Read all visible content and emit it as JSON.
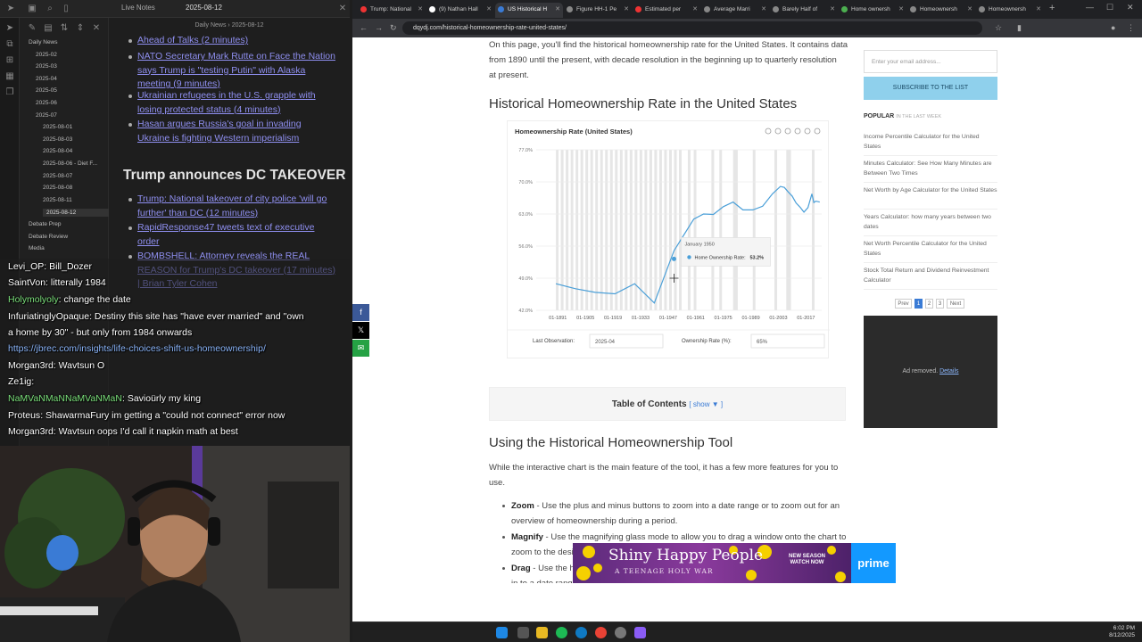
{
  "notes": {
    "tab_live_notes": "Live Notes",
    "tab_date": "2025-08-12",
    "doc_header": "Daily News › 2025-08-12",
    "tree": [
      {
        "label": "Daily News",
        "indent": 0
      },
      {
        "label": "2025-02",
        "indent": 1
      },
      {
        "label": "2025-03",
        "indent": 1
      },
      {
        "label": "2025-04",
        "indent": 1
      },
      {
        "label": "2025-05",
        "indent": 1
      },
      {
        "label": "2025-06",
        "indent": 1
      },
      {
        "label": "2025-07",
        "indent": 1
      },
      {
        "label": "2025-08-01",
        "indent": 2
      },
      {
        "label": "2025-08-03",
        "indent": 2
      },
      {
        "label": "2025-08-04",
        "indent": 2
      },
      {
        "label": "2025-08-06 - Diet F...",
        "indent": 2
      },
      {
        "label": "2025-08-07",
        "indent": 2
      },
      {
        "label": "2025-08-08",
        "indent": 2
      },
      {
        "label": "2025-08-11",
        "indent": 2
      },
      {
        "label": "2025-08-12",
        "indent": 2,
        "selected": true
      },
      {
        "label": "Debate Prep",
        "indent": 0
      },
      {
        "label": "Debate Review",
        "indent": 0
      },
      {
        "label": "Media",
        "indent": 0
      }
    ],
    "links_top": [
      "Ahead of Talks (2 minutes)",
      "NATO Secretary Mark Rutte on Face the Nation says Trump is \"testing Putin\" with Alaska meeting (9 minutes)",
      "Ukrainian refugees in the U.S. grapple with losing protected status (4 minutes)",
      "Hasan argues Russia's goal in invading Ukraine is fighting Western imperialism"
    ],
    "heading": "Trump announces DC TAKEOVER",
    "links_bottom": [
      "Trump: National takeover of city police 'will go further' than DC (12 minutes)",
      "RapidResponse47 tweets text of executive order",
      "BOMBSHELL: Attorney reveals the REAL REASON for Trump's DC takeover (17 minutes) | Brian Tyler Cohen"
    ]
  },
  "chat": [
    {
      "user": "Levi_OP",
      "text": "Bill_Dozer",
      "color": "white"
    },
    {
      "user": "SaintVon",
      "text": "litterally 1984",
      "color": "white"
    },
    {
      "user": "Holymolyoly",
      "text": "change the date",
      "color": "green"
    },
    {
      "user": "InfuriatinglyOpaque",
      "text": "Destiny this site has \"have ever married\" and \"own",
      "color": "white"
    },
    {
      "user": "",
      "text": "a home by 30\" - but only from 1984 onwards",
      "color": "white"
    },
    {
      "user": "",
      "text": "https://jbrec.com/insights/life-choices-shift-us-homeownership/",
      "color": "link"
    },
    {
      "user": "Morgan3rd",
      "text": "Wavtsun O",
      "color": "white"
    },
    {
      "user": "Ze1ig",
      "text": "",
      "color": "white"
    },
    {
      "user": "NaMVaNMaNNaMVaNMaN",
      "text": "Savioürly my king",
      "color": "green"
    },
    {
      "user": "Proteus",
      "text": "ShawarmaFury im getting a \"could not connect\" error now",
      "color": "white"
    },
    {
      "user": "Morgan3rd",
      "text": "Wavtsun oops I'd call it napkin math at best",
      "color": "white"
    }
  ],
  "browser": {
    "tabs": [
      {
        "label": "Trump: National",
        "color": "#e33"
      },
      {
        "label": "(9) Nathan Hall",
        "color": "#fff"
      },
      {
        "label": "US Historical H",
        "color": "#3a7bd5",
        "active": true
      },
      {
        "label": "Figure HH-1 Pe",
        "color": "#888"
      },
      {
        "label": "Estimated per",
        "color": "#e33"
      },
      {
        "label": "Average Marri",
        "color": "#888"
      },
      {
        "label": "Barely Half of",
        "color": "#888"
      },
      {
        "label": "Home ownersh",
        "color": "#4caf50"
      },
      {
        "label": "Homeownersh",
        "color": "#888"
      },
      {
        "label": "Homeownersh",
        "color": "#888"
      }
    ],
    "url": "dqydj.com/historical-homeownership-rate-united-states/"
  },
  "page": {
    "intro_1": "On this page, you'll find the historical homeownership rate for the United States. It contains data",
    "intro_2": "from 1890 until the present, with decade resolution in the beginning up to quarterly resolution",
    "intro_3": "at present.",
    "heading_1": "Historical Homeownership Rate in the United States",
    "toc_label": "Table of Contents",
    "toc_show": "[ show ▼ ]",
    "heading_2": "Using the Historical Homeownership Tool",
    "using_1": "While the interactive chart is the main feature of the tool, it has a few more features for you to",
    "using_2": "use.",
    "features": [
      {
        "name": "Zoom",
        "text": " - Use the plus and minus buttons to zoom into a date range or to zoom out for an",
        "text2": "overview of homeownership during a period."
      },
      {
        "name": "Magnify",
        "text": " - Use the magnifying glass mode to allow you to drag a window onto the chart to",
        "text2": "zoom to the desired period."
      },
      {
        "name": "Drag",
        "text": " - Use the hand icon to drag dates to past or future when you are currently zoomed",
        "text2": "in to a date range."
      }
    ]
  },
  "sidebar": {
    "email_placeholder": "Enter your email address...",
    "subscribe": "SUBSCRIBE TO THE LIST",
    "popular": "POPULAR",
    "popular_sub": "IN THE LAST WEEK",
    "items": [
      "Income Percentile Calculator for the United States",
      "Minutes Calculator: See How Many Minutes are Between Two Times",
      "Net Worth by Age Calculator for the United States",
      "Years Calculator: how many years between two dates",
      "Net Worth Percentile Calculator for the United States",
      "Stock Total Return and Dividend Reinvestment Calculator"
    ],
    "pager": [
      "Prev",
      "1",
      "2",
      "3",
      "Next"
    ],
    "ad_removed": "Ad removed.",
    "ad_details": "Details"
  },
  "ad_banner": {
    "title": "Shiny Happy People",
    "subtitle": "A TEENAGE HOLY WAR",
    "new_season": "NEW SEASON WATCH NOW",
    "prime": "prime"
  },
  "taskbar": {
    "time": "6:02 PM",
    "date": "8/12/2025"
  },
  "chart_data": {
    "type": "line",
    "title": "Homeownership Rate (United States)",
    "series": [
      {
        "name": "Home Ownership Rate",
        "color": "#4a9fd8"
      }
    ],
    "x_tick_labels": [
      "01-1891",
      "01-1905",
      "01-1919",
      "01-1933",
      "01-1947",
      "01-1961",
      "01-1975",
      "01-1989",
      "01-2003",
      "01-2017"
    ],
    "y_tick_labels": [
      "42.0%",
      "49.0%",
      "56.0%",
      "63.0%",
      "70.0%",
      "77.0%"
    ],
    "ylim": [
      42,
      77
    ],
    "xlim": [
      1880,
      2025
    ],
    "x": [
      1890,
      1900,
      1910,
      1920,
      1930,
      1940,
      1950,
      1960,
      1965,
      1970,
      1975,
      1980,
      1985,
      1990,
      1995,
      2000,
      2004,
      2006,
      2008,
      2010,
      2012,
      2014,
      2016,
      2018,
      2020,
      2021,
      2022,
      2024
    ],
    "y": [
      47.8,
      46.7,
      45.9,
      45.6,
      47.8,
      43.6,
      55.0,
      61.9,
      63.0,
      62.9,
      64.6,
      65.6,
      63.9,
      63.9,
      64.7,
      67.4,
      69.0,
      68.8,
      67.8,
      66.9,
      65.4,
      64.5,
      63.4,
      64.4,
      67.4,
      65.5,
      65.8,
      65.6
    ],
    "tooltip": {
      "date": "January 1950",
      "label": "Home Ownership Rate:",
      "value": "53.2%"
    },
    "last_observation_label": "Last Observation:",
    "last_observation": "2025-04",
    "ownership_rate_label": "Ownership Rate (%):",
    "ownership_rate": "65%"
  }
}
